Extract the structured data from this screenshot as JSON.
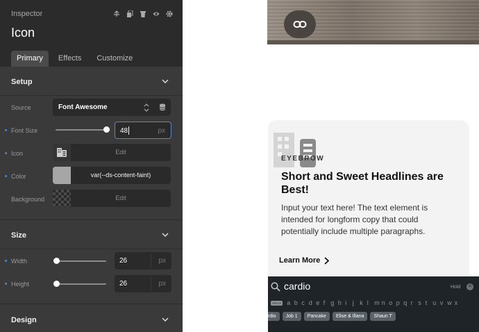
{
  "inspector": {
    "label": "Inspector",
    "title": "Icon",
    "header_icons": [
      "align-icon",
      "duplicate-icon",
      "trash-icon",
      "eye-icon",
      "gear-icon"
    ],
    "tabs": [
      {
        "label": "Primary",
        "active": true
      },
      {
        "label": "Effects",
        "active": false
      },
      {
        "label": "Customize",
        "active": false
      }
    ],
    "setup": {
      "title": "Setup",
      "source": {
        "label": "Source",
        "value": "Font Awesome"
      },
      "font_size": {
        "label": "Font Size",
        "value": "48",
        "unit": "px",
        "slider_fraction": 1.0
      },
      "icon": {
        "label": "Icon",
        "action": "Edit"
      },
      "color": {
        "label": "Color",
        "value": "var(--ds-content-faint)",
        "swatch": "#a6a6a6"
      },
      "background": {
        "label": "Background",
        "action": "Edit"
      }
    },
    "size": {
      "title": "Size",
      "width": {
        "label": "Width",
        "value": "26",
        "unit": "px",
        "slider_fraction": 0.0
      },
      "height": {
        "label": "Height",
        "value": "26",
        "unit": "px",
        "slider_fraction": 0.0
      }
    },
    "design": {
      "title": "Design"
    },
    "colors": {
      "accent": "#3b8ee8",
      "panel": "#3a3a3a",
      "header": "#2b2b2b",
      "field": "#2a2a2a"
    }
  },
  "canvas": {
    "card": {
      "eyebrow": "EYEBROW",
      "headline": "Short and Sweet Headlines are Best!",
      "body": "Input your text here! The text element is intended for longform copy that could potentially include multiple paragraphs.",
      "cta": "Learn More"
    },
    "search_panel": {
      "query": "cardio",
      "hold": "Hold",
      "hold_close": "✕",
      "space_label": "SPACE",
      "letters": [
        "a",
        "b",
        "c",
        "d",
        "e",
        "f",
        "g",
        "h",
        "i",
        "j",
        "k",
        "l",
        "m",
        "n",
        "o",
        "p",
        "q",
        "r",
        "s",
        "t",
        "u",
        "v",
        "w",
        "x"
      ],
      "chips": [
        "ardio",
        "Job 1",
        "Pancake",
        "Elise & Illana",
        "Shaun T"
      ]
    }
  }
}
